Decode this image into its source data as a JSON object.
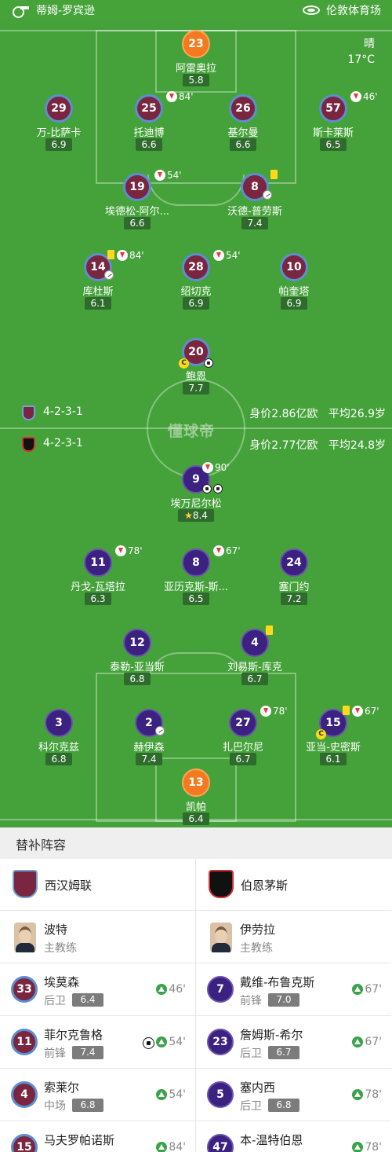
{
  "header": {
    "referee": "蒂姆-罗宾逊",
    "stadium": "伦敦体育场"
  },
  "weather": {
    "condition": "晴",
    "temp": "17°C"
  },
  "watermark": "懂球帝",
  "home": {
    "formation": "4-2-3-1",
    "value": "身价2.86亿欧",
    "age": "平均26.9岁",
    "color": "#7a2640"
  },
  "away": {
    "formation": "4-2-3-1",
    "value": "身价2.77亿欧",
    "age": "平均24.8岁",
    "color": "#3b2180"
  },
  "home_players": [
    {
      "num": "23",
      "name": "阿雷奥拉",
      "rating": "5.8"
    },
    {
      "num": "29",
      "name": "万-比萨卡",
      "rating": "6.9"
    },
    {
      "num": "25",
      "name": "托迪博",
      "rating": "6.6",
      "sub": "84'"
    },
    {
      "num": "26",
      "name": "基尔曼",
      "rating": "6.6"
    },
    {
      "num": "57",
      "name": "斯卡莱斯",
      "rating": "6.5",
      "sub": "46'"
    },
    {
      "num": "19",
      "name": "埃德松-阿尔...",
      "rating": "6.6",
      "sub": "54'"
    },
    {
      "num": "8",
      "name": "沃德-普劳斯",
      "rating": "7.4"
    },
    {
      "num": "14",
      "name": "库杜斯",
      "rating": "6.1",
      "sub": "84'"
    },
    {
      "num": "28",
      "name": "绍切克",
      "rating": "6.9",
      "sub": "54'"
    },
    {
      "num": "10",
      "name": "帕奎塔",
      "rating": "6.9"
    },
    {
      "num": "20",
      "name": "鲍恩",
      "rating": "7.7"
    }
  ],
  "away_players": [
    {
      "num": "9",
      "name": "埃万尼尔松",
      "rating": "8.4",
      "sub": "90'"
    },
    {
      "num": "11",
      "name": "丹戈-瓦塔拉",
      "rating": "6.3",
      "sub": "78'"
    },
    {
      "num": "8",
      "name": "亚历克斯-斯...",
      "rating": "6.5",
      "sub": "67'"
    },
    {
      "num": "24",
      "name": "塞门约",
      "rating": "7.2"
    },
    {
      "num": "12",
      "name": "泰勒-亚当斯",
      "rating": "6.8"
    },
    {
      "num": "4",
      "name": "刘易斯-库克",
      "rating": "6.7"
    },
    {
      "num": "3",
      "name": "科尔克兹",
      "rating": "6.8"
    },
    {
      "num": "2",
      "name": "赫伊森",
      "rating": "7.4"
    },
    {
      "num": "27",
      "name": "扎巴尔尼",
      "rating": "6.7",
      "sub": "78'"
    },
    {
      "num": "15",
      "name": "亚当-史密斯",
      "rating": "6.1",
      "sub": "67'"
    },
    {
      "num": "13",
      "name": "凯帕",
      "rating": "6.4"
    }
  ],
  "subs": {
    "title": "替补阵容",
    "home_team": "西汉姆联",
    "away_team": "伯恩茅斯",
    "home_coach": {
      "name": "波特",
      "role": "主教练"
    },
    "away_coach": {
      "name": "伊劳拉",
      "role": "主教练"
    },
    "home": [
      {
        "num": "33",
        "name": "埃莫森",
        "pos": "后卫",
        "rating": "6.4",
        "min": "46'"
      },
      {
        "num": "11",
        "name": "菲尔克鲁格",
        "pos": "前锋",
        "rating": "7.4",
        "min": "54'"
      },
      {
        "num": "4",
        "name": "索莱尔",
        "pos": "中场",
        "rating": "6.8",
        "min": "54'"
      },
      {
        "num": "15",
        "name": "马夫罗帕诺斯",
        "min": "84'"
      }
    ],
    "away": [
      {
        "num": "7",
        "name": "戴维-布鲁克斯",
        "pos": "前锋",
        "rating": "7.0",
        "min": "67'"
      },
      {
        "num": "23",
        "name": "詹姆斯-希尔",
        "pos": "后卫",
        "rating": "6.7",
        "min": "67'"
      },
      {
        "num": "5",
        "name": "塞内西",
        "pos": "后卫",
        "rating": "6.8",
        "min": "78'"
      },
      {
        "num": "47",
        "name": "本-温特伯恩",
        "min": "78'"
      }
    ]
  }
}
